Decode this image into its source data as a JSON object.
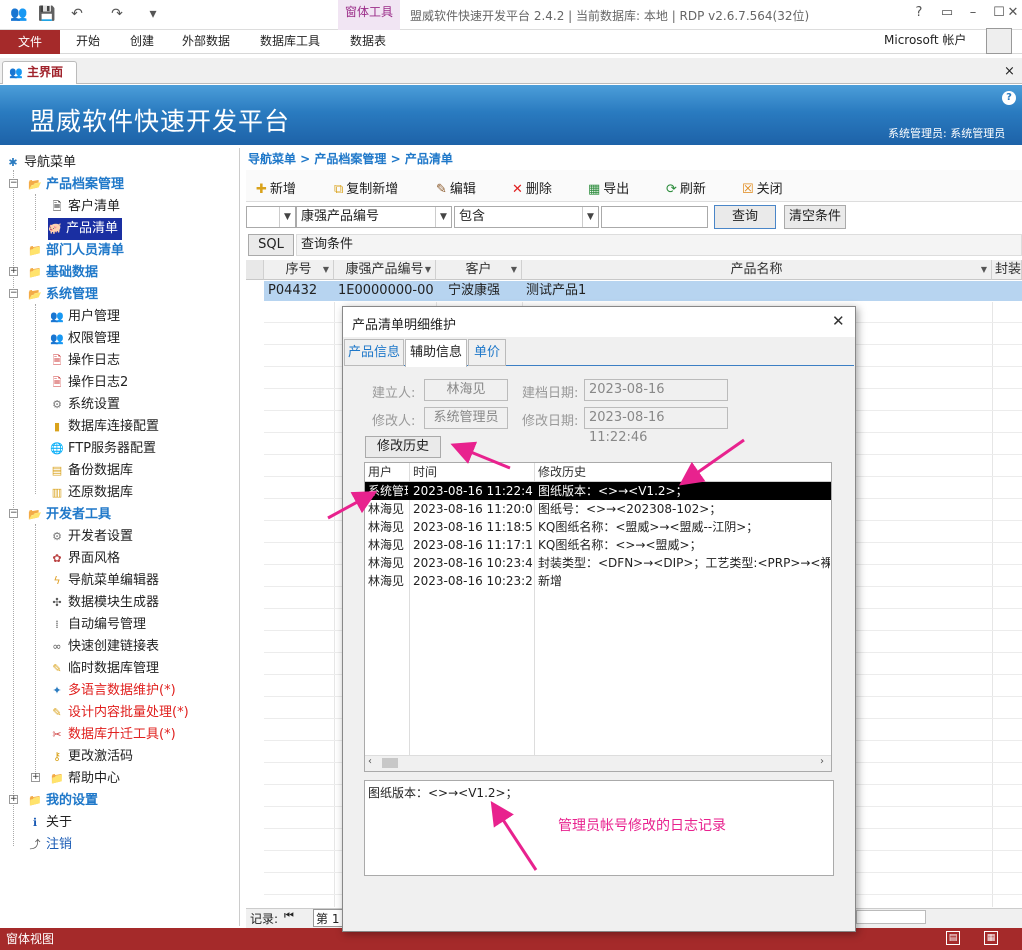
{
  "app": {
    "ribbon_tabs": [
      "文件",
      "开始",
      "创建",
      "外部数据",
      "数据库工具",
      "数据表"
    ],
    "context_tab_group": "窗体工具",
    "title": "盟威软件快速开发平台 2.4.2 | 当前数据库: 本地 | RDP v2.6.7.564(32位)",
    "account": "Microsoft 帐户",
    "help": "?"
  },
  "document_tab": {
    "label": "主界面",
    "close": "×"
  },
  "banner": {
    "title": "盟威软件快速开发平台",
    "user_info": "系统管理员: 系统管理员"
  },
  "nav": {
    "root": "导航菜单",
    "items": [
      {
        "label": "产品档案管理",
        "type": "group",
        "expanded": true
      },
      {
        "label": "客户清单",
        "type": "item",
        "icon": "document-icon"
      },
      {
        "label": "产品清单",
        "type": "item",
        "icon": "product-icon",
        "selected": true
      },
      {
        "label": "部门人员清单",
        "type": "group"
      },
      {
        "label": "基础数据",
        "type": "group",
        "collapsed": true
      },
      {
        "label": "系统管理",
        "type": "group",
        "expanded": true
      },
      {
        "label": "用户管理",
        "type": "item",
        "icon": "users-icon"
      },
      {
        "label": "权限管理",
        "type": "item",
        "icon": "users-icon"
      },
      {
        "label": "操作日志",
        "type": "item",
        "icon": "log-icon"
      },
      {
        "label": "操作日志2",
        "type": "item",
        "icon": "log-icon"
      },
      {
        "label": "系统设置",
        "type": "item",
        "icon": "gear-icon"
      },
      {
        "label": "数据库连接配置",
        "type": "item",
        "icon": "database-icon"
      },
      {
        "label": "FTP服务器配置",
        "type": "item",
        "icon": "globe-icon"
      },
      {
        "label": "备份数据库",
        "type": "item",
        "icon": "backup-icon"
      },
      {
        "label": "还原数据库",
        "type": "item",
        "icon": "restore-icon"
      },
      {
        "label": "开发者工具",
        "type": "group",
        "expanded": true
      },
      {
        "label": "开发者设置",
        "type": "item",
        "icon": "gear-icon"
      },
      {
        "label": "界面风格",
        "type": "item",
        "icon": "palette-icon"
      },
      {
        "label": "导航菜单编辑器",
        "type": "item",
        "icon": "lightning-icon"
      },
      {
        "label": "数据模块生成器",
        "type": "item",
        "icon": "module-icon"
      },
      {
        "label": "自动编号管理",
        "type": "item",
        "icon": "numbering-icon"
      },
      {
        "label": "快速创建链接表",
        "type": "item",
        "icon": "link-icon"
      },
      {
        "label": "临时数据库管理",
        "type": "item",
        "icon": "edit-icon"
      },
      {
        "label": "多语言数据维护(*)",
        "type": "item",
        "icon": "language-icon",
        "red": true
      },
      {
        "label": "设计内容批量处理(*)",
        "type": "item",
        "icon": "edit-icon",
        "red": true
      },
      {
        "label": "数据库升迁工具(*)",
        "type": "item",
        "icon": "tool-icon",
        "red": true
      },
      {
        "label": "更改激活码",
        "type": "item",
        "icon": "key-icon"
      },
      {
        "label": "帮助中心",
        "type": "folder",
        "collapsed": true
      },
      {
        "label": "我的设置",
        "type": "group",
        "collapsed": true
      },
      {
        "label": "关于",
        "type": "root-item",
        "icon": "info-icon"
      },
      {
        "label": "注销",
        "type": "root-item",
        "icon": "logout-icon",
        "blue": true
      }
    ]
  },
  "breadcrumb": "导航菜单 > 产品档案管理 > 产品清单",
  "toolbar": [
    {
      "label": "新增",
      "icon": "new-icon"
    },
    {
      "label": "复制新增",
      "icon": "copy-icon"
    },
    {
      "label": "编辑",
      "icon": "edit-icon"
    },
    {
      "label": "删除",
      "icon": "delete-icon"
    },
    {
      "label": "导出",
      "icon": "export-icon"
    },
    {
      "label": "刷新",
      "icon": "refresh-icon"
    },
    {
      "label": "关闭",
      "icon": "close-icon"
    }
  ],
  "filter": {
    "field1": "",
    "field2": "康强产品编号",
    "operator": "包含",
    "value": "",
    "query": "查询",
    "clear": "清空条件",
    "sql": "SQL",
    "condition": "查询条件"
  },
  "grid": {
    "columns": [
      "序号",
      "康强产品编号",
      "客户",
      "产品名称",
      "封装"
    ],
    "rows": [
      [
        "P04432",
        "1E0000000-00",
        "宁波康强",
        "测试产品1",
        ""
      ]
    ]
  },
  "record_nav": {
    "label": "记录:",
    "first": "⏮",
    "page": "第 1"
  },
  "dialog": {
    "title": "产品清单明细维护",
    "close": "✕",
    "tabs": [
      "产品信息",
      "辅助信息",
      "单价"
    ],
    "active_tab": 1,
    "creator_label": "建立人:",
    "creator": "林海见",
    "created_label": "建档日期:",
    "created": "2023-08-16",
    "modifier_label": "修改人:",
    "modifier": "系统管理员",
    "modified_label": "修改日期:",
    "modified": "2023-08-16 11:22:46",
    "history_button": "修改历史",
    "history_columns": [
      "用户",
      "时间",
      "修改历史"
    ],
    "history_rows": [
      [
        "系统管理员",
        "2023-08-16 11:22:48",
        "图纸版本：<>→<V1.2>；"
      ],
      [
        "林海见",
        "2023-08-16 11:20:06",
        "图纸号：<>→<202308-102>；"
      ],
      [
        "林海见",
        "2023-08-16 11:18:59",
        "KQ图纸名称：<盟威>→<盟威--江阴>；"
      ],
      [
        "林海见",
        "2023-08-16 11:17:12",
        "KQ图纸名称：<>→<盟威>；"
      ],
      [
        "林海见",
        "2023-08-16 10:23:44",
        "封装类型：<DFN>→<DIP>；工艺类型:<PRP>→<裸铜"
      ],
      [
        "林海见",
        "2023-08-16 10:23:21",
        "新增"
      ]
    ],
    "detail_text": "图纸版本：<>→<V1.2>；",
    "annotation": "管理员帐号修改的日志记录"
  },
  "status": {
    "left": "窗体视图"
  }
}
